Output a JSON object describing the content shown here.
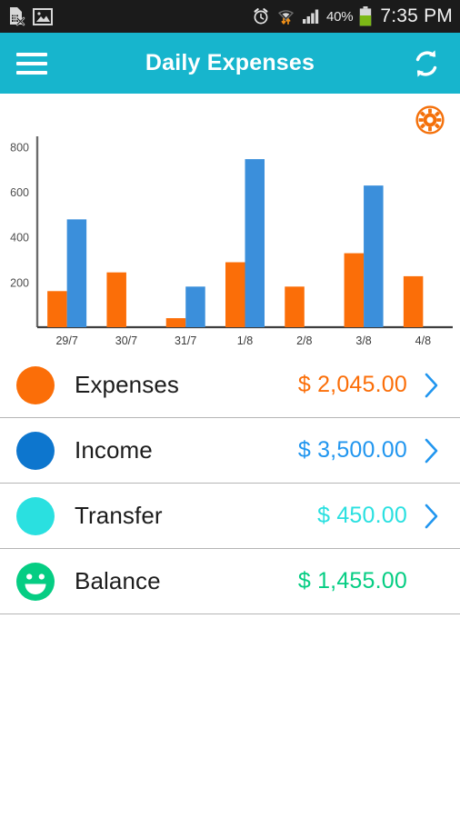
{
  "statusbar": {
    "icons_left": [
      "sim-card-removed-icon",
      "gallery-image-icon"
    ],
    "icons_right": [
      "alarm-clock-icon",
      "wifi-transfer-icon",
      "signal-bars-icon",
      "battery-icon"
    ],
    "battery_percent": "40%",
    "time": "7:35 PM"
  },
  "appbar": {
    "menu_icon": "hamburger-menu-icon",
    "title": "Daily Expenses",
    "refresh_icon": "refresh-sync-icon",
    "background": "#17b5cd"
  },
  "chart_card": {
    "settings_icon": "gear-settings-icon",
    "settings_color": "#f4700a"
  },
  "chart_data": {
    "type": "bar",
    "title": "",
    "xlabel": "",
    "ylabel": "",
    "categories": [
      "29/7",
      "30/7",
      "31/7",
      "1/8",
      "2/8",
      "3/8",
      "4/8"
    ],
    "yticks": [
      200,
      400,
      600,
      800
    ],
    "ylim": [
      0,
      830
    ],
    "grid": false,
    "legend": "none",
    "series": [
      {
        "name": "Expenses",
        "color": "#fb6e08",
        "values": [
          160,
          243,
          40,
          288,
          180,
          328,
          226
        ]
      },
      {
        "name": "Income",
        "color": "#3b8fdb",
        "values": [
          478,
          0,
          180,
          745,
          0,
          628,
          0
        ]
      }
    ]
  },
  "summary": {
    "rows": [
      {
        "icon": "orange-dot-icon",
        "color": "#fb6e08",
        "label": "Expenses",
        "amount": "$ 2,045.00",
        "amount_color": "#fb6e08",
        "chevron": true
      },
      {
        "icon": "blue-dot-icon",
        "color": "#0d76ce",
        "label": "Income",
        "amount": "$ 3,500.00",
        "amount_color": "#2196ef",
        "chevron": true
      },
      {
        "icon": "cyan-dot-icon",
        "color": "#2ae0e0",
        "label": "Transfer",
        "amount": "$ 450.00",
        "amount_color": "#2ae0e0",
        "chevron": true
      },
      {
        "icon": "green-smiley-icon",
        "color": "#05cd83",
        "label": "Balance",
        "amount": "$ 1,455.00",
        "amount_color": "#05cd83",
        "chevron": false
      }
    ],
    "chevron_icon": "chevron-right-icon",
    "chevron_color": "#2196ef"
  }
}
